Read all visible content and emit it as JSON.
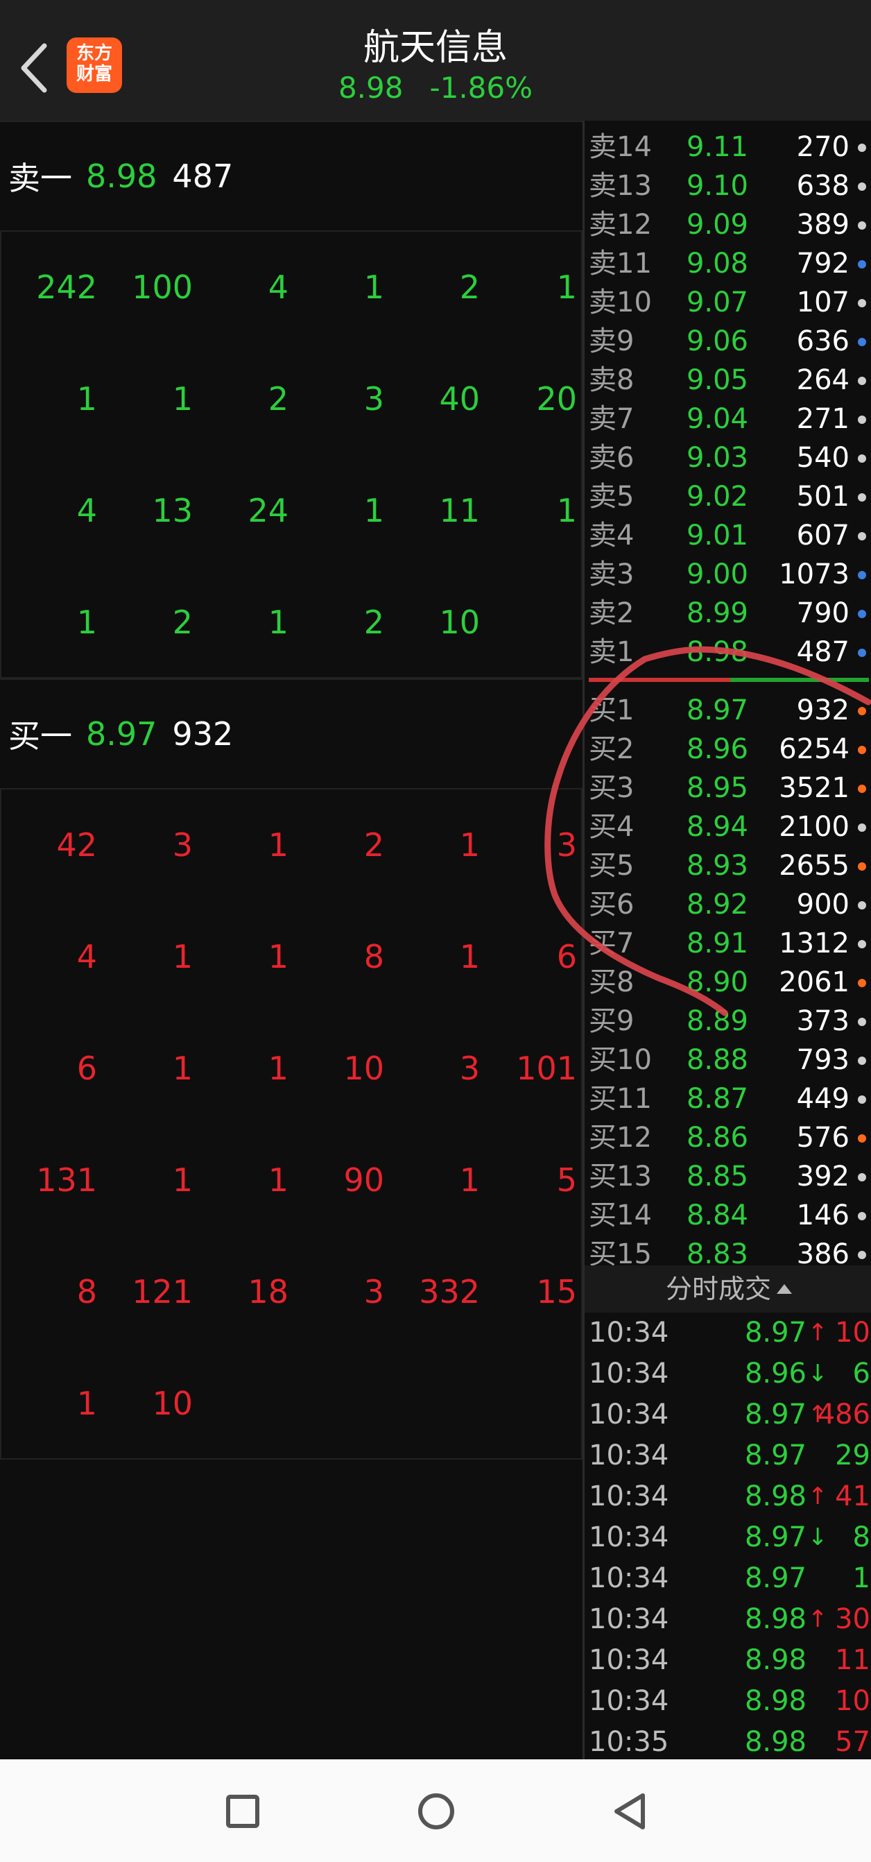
{
  "header": {
    "title": "航天信息",
    "price": "8.98",
    "change": "-1.86%",
    "logo_line1": "东方",
    "logo_line2": "财富"
  },
  "left_panel": {
    "sell_one": {
      "label": "卖一",
      "price": "8.98",
      "volume": "487"
    },
    "sell_grid": [
      [
        "242",
        "100",
        "4",
        "1",
        "2",
        "1"
      ],
      [
        "1",
        "1",
        "2",
        "3",
        "40",
        "20"
      ],
      [
        "4",
        "13",
        "24",
        "1",
        "11",
        "1"
      ],
      [
        "1",
        "2",
        "1",
        "2",
        "10",
        ""
      ]
    ],
    "buy_one": {
      "label": "买一",
      "price": "8.97",
      "volume": "932"
    },
    "buy_grid": [
      [
        "42",
        "3",
        "1",
        "2",
        "1",
        "3"
      ],
      [
        "4",
        "1",
        "1",
        "8",
        "1",
        "6"
      ],
      [
        "6",
        "1",
        "1",
        "10",
        "3",
        "101"
      ],
      [
        "131",
        "1",
        "1",
        "90",
        "1",
        "5"
      ],
      [
        "8",
        "121",
        "18",
        "3",
        "332",
        "15"
      ],
      [
        "1",
        "10",
        "",
        "",
        "",
        ""
      ]
    ]
  },
  "order_book": {
    "asks": [
      {
        "label": "卖14",
        "price": "9.11",
        "volume": "270",
        "dot": "gray"
      },
      {
        "label": "卖13",
        "price": "9.10",
        "volume": "638",
        "dot": "gray"
      },
      {
        "label": "卖12",
        "price": "9.09",
        "volume": "389",
        "dot": "gray"
      },
      {
        "label": "卖11",
        "price": "9.08",
        "volume": "792",
        "dot": "blue"
      },
      {
        "label": "卖10",
        "price": "9.07",
        "volume": "107",
        "dot": "gray"
      },
      {
        "label": "卖9",
        "price": "9.06",
        "volume": "636",
        "dot": "blue"
      },
      {
        "label": "卖8",
        "price": "9.05",
        "volume": "264",
        "dot": "gray"
      },
      {
        "label": "卖7",
        "price": "9.04",
        "volume": "271",
        "dot": "gray"
      },
      {
        "label": "卖6",
        "price": "9.03",
        "volume": "540",
        "dot": "gray"
      },
      {
        "label": "卖5",
        "price": "9.02",
        "volume": "501",
        "dot": "gray"
      },
      {
        "label": "卖4",
        "price": "9.01",
        "volume": "607",
        "dot": "gray"
      },
      {
        "label": "卖3",
        "price": "9.00",
        "volume": "1073",
        "dot": "blue"
      },
      {
        "label": "卖2",
        "price": "8.99",
        "volume": "790",
        "dot": "blue"
      },
      {
        "label": "卖1",
        "price": "8.98",
        "volume": "487",
        "dot": "blue"
      }
    ],
    "bids": [
      {
        "label": "买1",
        "price": "8.97",
        "volume": "932",
        "dot": "orange"
      },
      {
        "label": "买2",
        "price": "8.96",
        "volume": "6254",
        "dot": "orange"
      },
      {
        "label": "买3",
        "price": "8.95",
        "volume": "3521",
        "dot": "orange"
      },
      {
        "label": "买4",
        "price": "8.94",
        "volume": "2100",
        "dot": "gray"
      },
      {
        "label": "买5",
        "price": "8.93",
        "volume": "2655",
        "dot": "orange"
      },
      {
        "label": "买6",
        "price": "8.92",
        "volume": "900",
        "dot": "gray"
      },
      {
        "label": "买7",
        "price": "8.91",
        "volume": "1312",
        "dot": "gray"
      },
      {
        "label": "买8",
        "price": "8.90",
        "volume": "2061",
        "dot": "orange"
      },
      {
        "label": "买9",
        "price": "8.89",
        "volume": "373",
        "dot": "gray"
      },
      {
        "label": "买10",
        "price": "8.88",
        "volume": "793",
        "dot": "gray"
      },
      {
        "label": "买11",
        "price": "8.87",
        "volume": "449",
        "dot": "gray"
      },
      {
        "label": "买12",
        "price": "8.86",
        "volume": "576",
        "dot": "orange"
      },
      {
        "label": "买13",
        "price": "8.85",
        "volume": "392",
        "dot": "gray"
      },
      {
        "label": "买14",
        "price": "8.84",
        "volume": "146",
        "dot": "gray"
      },
      {
        "label": "买15",
        "price": "8.83",
        "volume": "386",
        "dot": "gray"
      }
    ]
  },
  "trades": {
    "header": "分时成交",
    "rows": [
      {
        "time": "10:34",
        "price": "8.97",
        "arrow": "↑",
        "volume": "10",
        "color": "red"
      },
      {
        "time": "10:34",
        "price": "8.96",
        "arrow": "↓",
        "volume": "6",
        "color": "green"
      },
      {
        "time": "10:34",
        "price": "8.97",
        "arrow": "↑",
        "volume": "486",
        "color": "red"
      },
      {
        "time": "10:34",
        "price": "8.97",
        "arrow": "",
        "volume": "29",
        "color": "green"
      },
      {
        "time": "10:34",
        "price": "8.98",
        "arrow": "↑",
        "volume": "41",
        "color": "red"
      },
      {
        "time": "10:34",
        "price": "8.97",
        "arrow": "↓",
        "volume": "8",
        "color": "green"
      },
      {
        "time": "10:34",
        "price": "8.97",
        "arrow": "",
        "volume": "1",
        "color": "green"
      },
      {
        "time": "10:34",
        "price": "8.98",
        "arrow": "↑",
        "volume": "30",
        "color": "red"
      },
      {
        "time": "10:34",
        "price": "8.98",
        "arrow": "",
        "volume": "11",
        "color": "red"
      },
      {
        "time": "10:34",
        "price": "8.98",
        "arrow": "",
        "volume": "10",
        "color": "red"
      },
      {
        "time": "10:35",
        "price": "8.98",
        "arrow": "",
        "volume": "57",
        "color": "red"
      }
    ]
  },
  "colors": {
    "up": "#e8242e",
    "down": "#2ccf3d",
    "brand": "#ff5a1f"
  },
  "navbar": {
    "icons": [
      "recents-square-icon",
      "home-circle-icon",
      "back-triangle-icon"
    ]
  }
}
